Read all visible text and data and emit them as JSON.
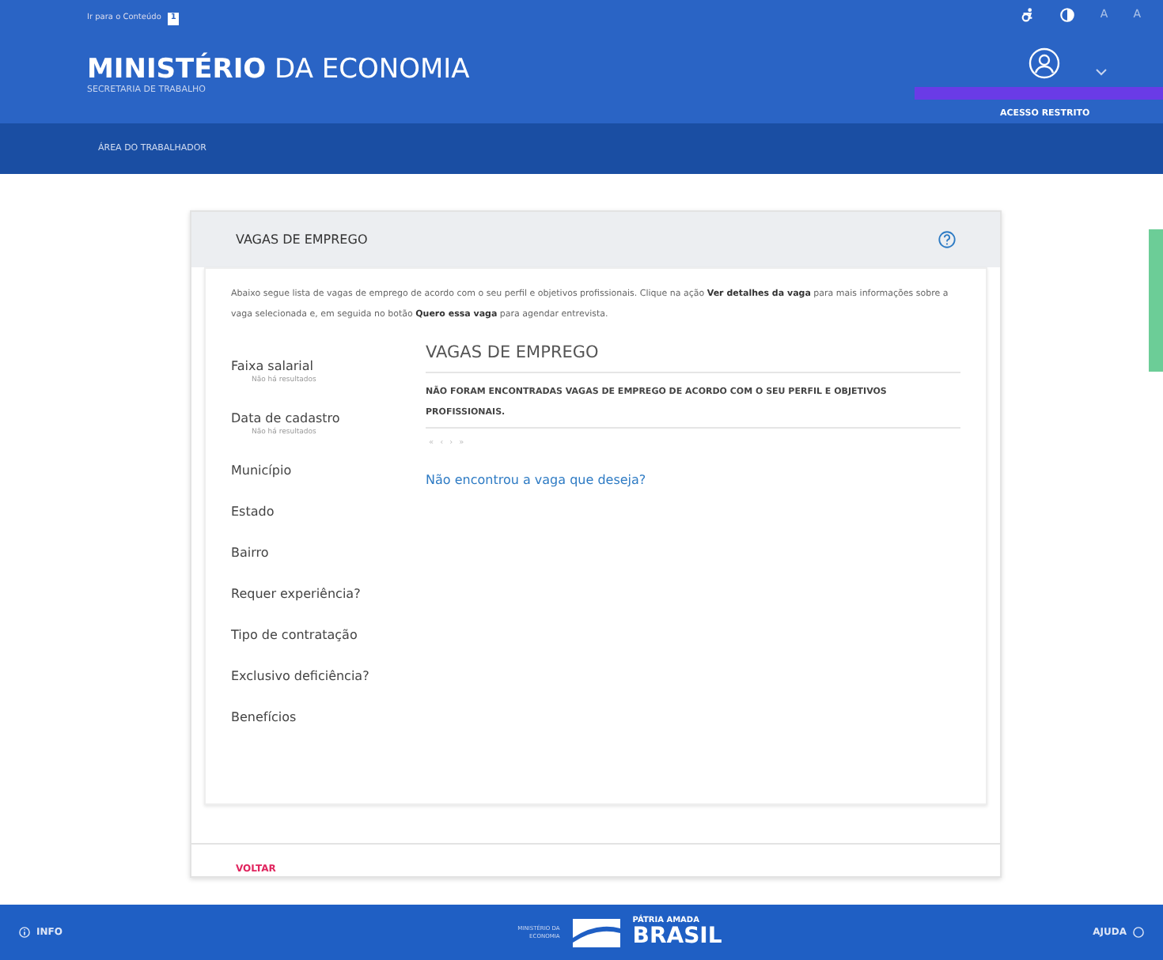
{
  "header": {
    "skip_link": "Ir para o Conteúdo",
    "skip_key": "1",
    "title": "**MINISTÉRIO** DA ECONOMIA",
    "subtitle": "SECRETARIA DE TRABALHO",
    "font_increase": "A",
    "font_decrease": "A",
    "restricted": "ACESSO RESTRITO"
  },
  "nav": {
    "items": [
      {
        "label": "ÁREA DO TRABALHADOR",
        "selected": false
      }
    ]
  },
  "card": {
    "title": "VAGAS DE EMPREGO",
    "intro": "Abaixo segue lista de vagas de emprego de acordo com o seu perfil e objetivos profissionais. Clique na ação **Ver detalhes da vaga** para mais informações sobre a vaga selecionada e, em seguida no botão **Quero essa vaga** para agendar entrevista.",
    "filters": [
      {
        "label": "Faixa salarial",
        "note": "Não há resultados"
      },
      {
        "label": "Data de cadastro",
        "note": "Não há resultados"
      },
      {
        "label": "Município"
      },
      {
        "label": "Estado"
      },
      {
        "label": "Bairro"
      },
      {
        "label": "Requer experiência?"
      },
      {
        "label": "Tipo de contratação"
      },
      {
        "label": "Exclusivo deficiência?"
      },
      {
        "label": "Benefícios"
      }
    ],
    "results_title": "VAGAS DE EMPREGO",
    "empty_message": "NÃO FORAM ENCONTRADAS VAGAS DE EMPREGO DE ACORDO COM O SEU PERFIL E OBJETIVOS PROFISSIONAIS.",
    "pager": [
      "«",
      "‹",
      "›",
      "»"
    ],
    "not_found_link": "Não encontrou a vaga que deseja?",
    "back": "VOLTAR"
  },
  "footer": {
    "info": "INFO",
    "ministry": "MINISTÉRIO DA ECONOMIA",
    "slogan": "PÁTRIA AMADA",
    "brand": "BRASIL",
    "help": "AJUDA"
  }
}
